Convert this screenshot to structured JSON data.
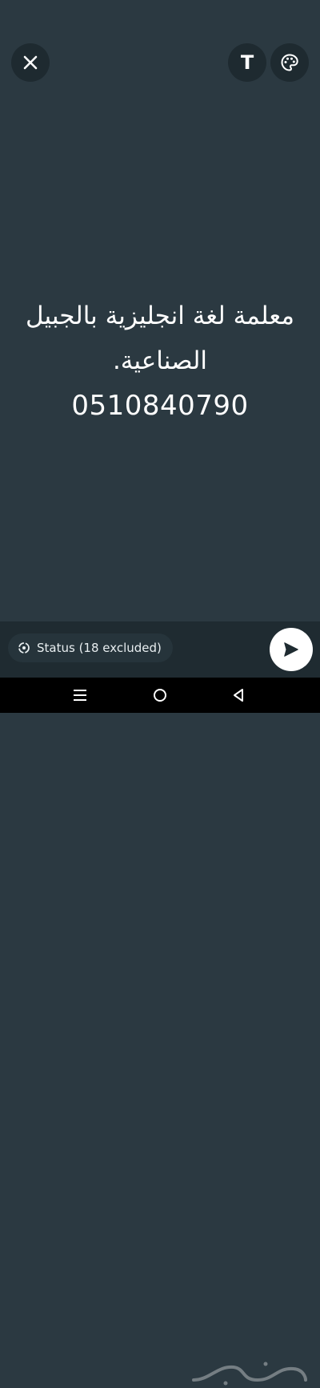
{
  "icons": {
    "close": "close-icon",
    "text": "text-format-icon",
    "palette": "palette-icon",
    "privacy": "privacy-status-icon",
    "send": "send-icon",
    "nav_menu": "recent-apps-icon",
    "nav_home": "home-icon",
    "nav_back": "back-icon"
  },
  "toolbar": {
    "text_label": "T"
  },
  "status": {
    "line1": "معلمة لغة انجليزية بالجبيل",
    "line2": "الصناعية.",
    "phone": "0510840790"
  },
  "footer": {
    "privacy_label": "Status (18 excluded)"
  },
  "colors": {
    "background": "#2b3941",
    "button_bg": "#1e2a30",
    "send_bg": "#ffffff"
  }
}
